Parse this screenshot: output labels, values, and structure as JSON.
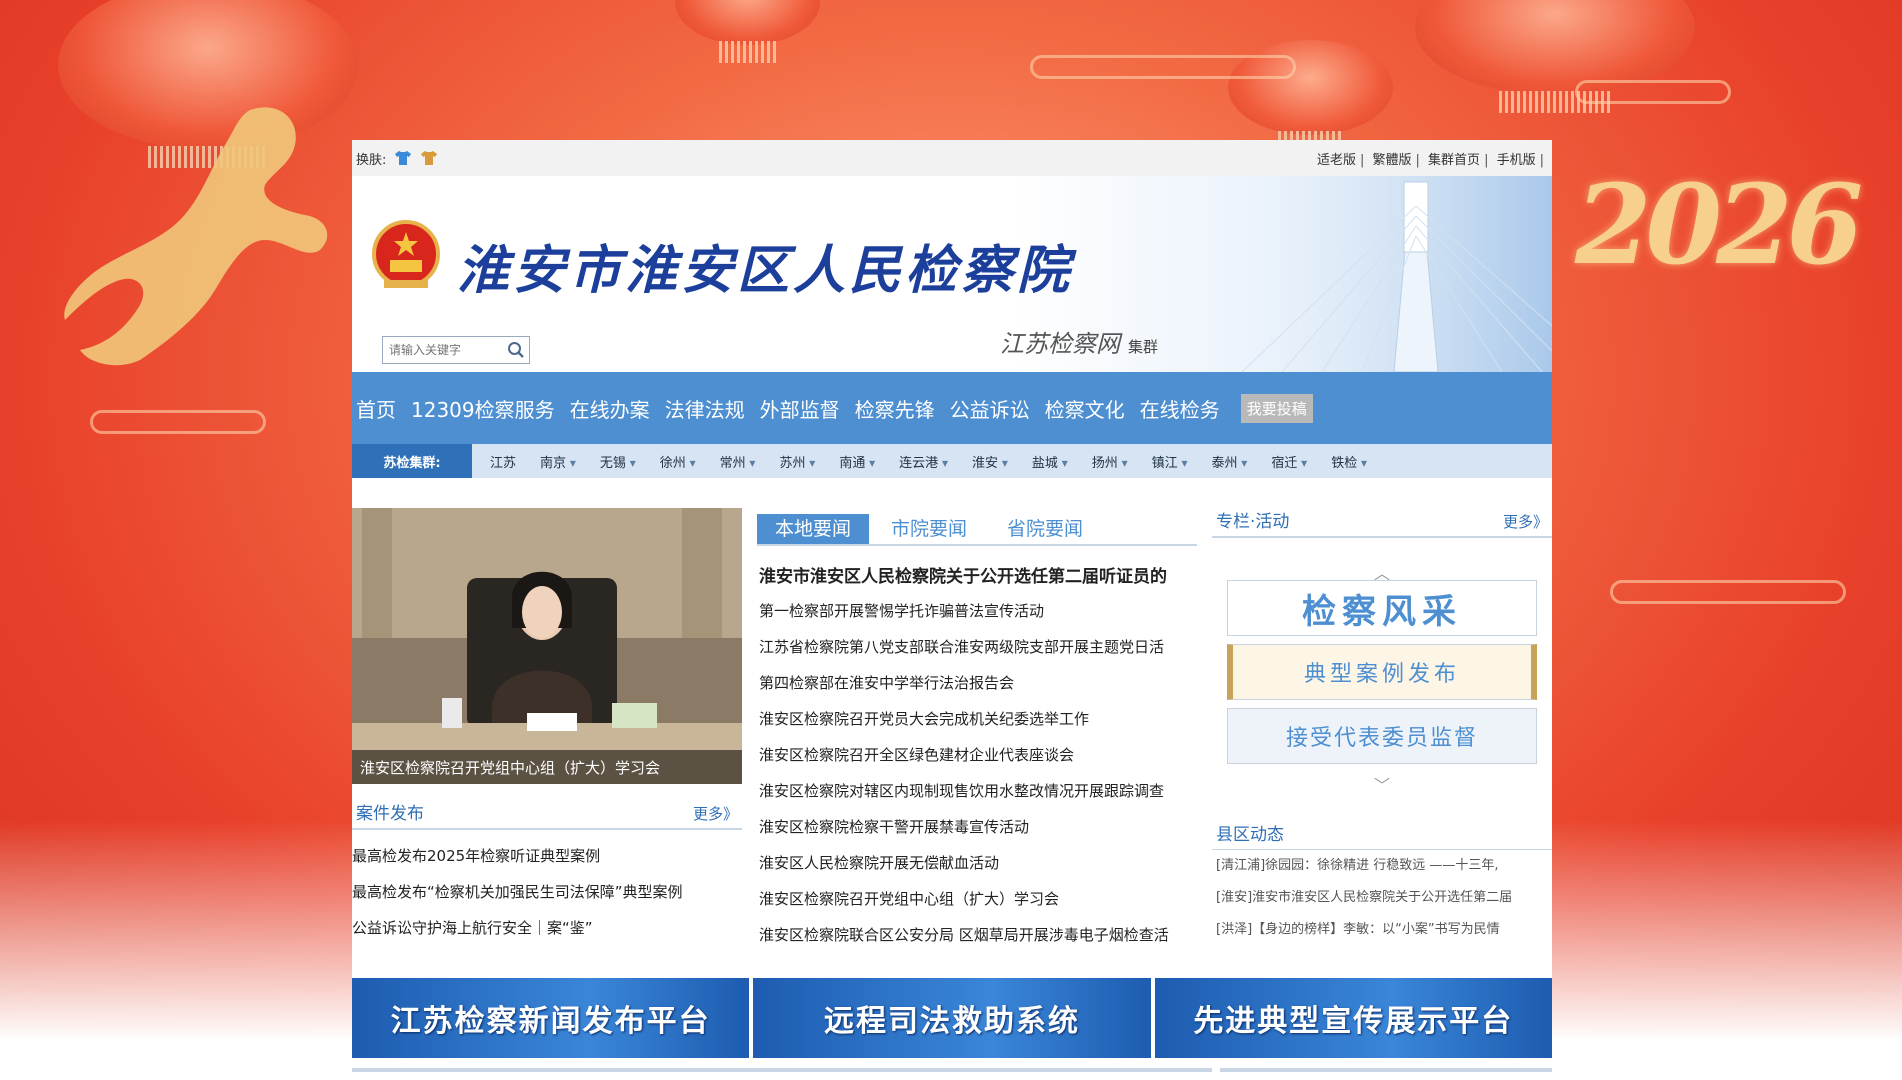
{
  "topbar": {
    "skin_label": "换肤:",
    "links": [
      "适老版",
      "繁體版",
      "集群首页",
      "手机版"
    ]
  },
  "header": {
    "title": "淮安市淮安区人民检察院",
    "brand": "江苏检察网",
    "brand_suffix": "集群",
    "year_deco": "2026"
  },
  "search": {
    "placeholder": "请输入关键字"
  },
  "nav": {
    "items": [
      "首页",
      "12309检察服务",
      "在线办案",
      "法律法规",
      "外部监督",
      "检察先锋",
      "公益诉讼",
      "检察文化",
      "在线检务"
    ],
    "contribute": "我要投稿"
  },
  "cluster": {
    "label": "苏检集群:",
    "cities": [
      "江苏",
      "南京",
      "无锡",
      "徐州",
      "常州",
      "苏州",
      "南通",
      "连云港",
      "淮安",
      "盐城",
      "扬州",
      "镇江",
      "泰州",
      "宿迁",
      "铁检"
    ]
  },
  "photo": {
    "caption": "淮安区检察院召开党组中心组（扩大）学习会"
  },
  "cases": {
    "title": "案件发布",
    "more": "更多》",
    "items": [
      "最高检发布2025年检察听证典型案例",
      "最高检发布“检察机关加强民生司法保障”典型案例",
      "公益诉讼守护海上航行安全｜案“鉴”"
    ]
  },
  "news": {
    "tabs": [
      "本地要闻",
      "市院要闻",
      "省院要闻"
    ],
    "headline": "淮安市淮安区人民检察院关于公开选任第二届听证员的",
    "items": [
      "第一检察部开展警惕学托诈骗普法宣传活动",
      "江苏省检察院第八党支部联合淮安两级院支部开展主题党日活",
      "第四检察部在淮安中学举行法治报告会",
      "淮安区检察院召开党员大会完成机关纪委选举工作",
      "淮安区检察院召开全区绿色建材企业代表座谈会",
      "淮安区检察院对辖区内现制现售饮用水整改情况开展跟踪调查",
      "淮安区检察院检察干警开展禁毒宣传活动",
      "淮安区人民检察院开展无偿献血活动",
      "淮安区检察院召开党组中心组（扩大）学习会",
      "淮安区检察院联合区公安分局 区烟草局开展涉毒电子烟检查活"
    ]
  },
  "side": {
    "title": "专栏·活动",
    "more": "更多》",
    "promos": [
      "检察风采",
      "典型案例发布",
      "接受代表委员监督"
    ],
    "county_title": "县区动态",
    "county_items": [
      "[清江浦]徐园园：徐徐精进 行稳致远 ——十三年,",
      "[淮安]淮安市淮安区人民检察院关于公开选任第二届",
      "[洪泽]【身边的榜样】李敏：以“小案”书写为民情"
    ]
  },
  "banners": [
    "江苏检察新闻发布平台",
    "远程司法救助系统",
    "先进典型宣传展示平台"
  ]
}
